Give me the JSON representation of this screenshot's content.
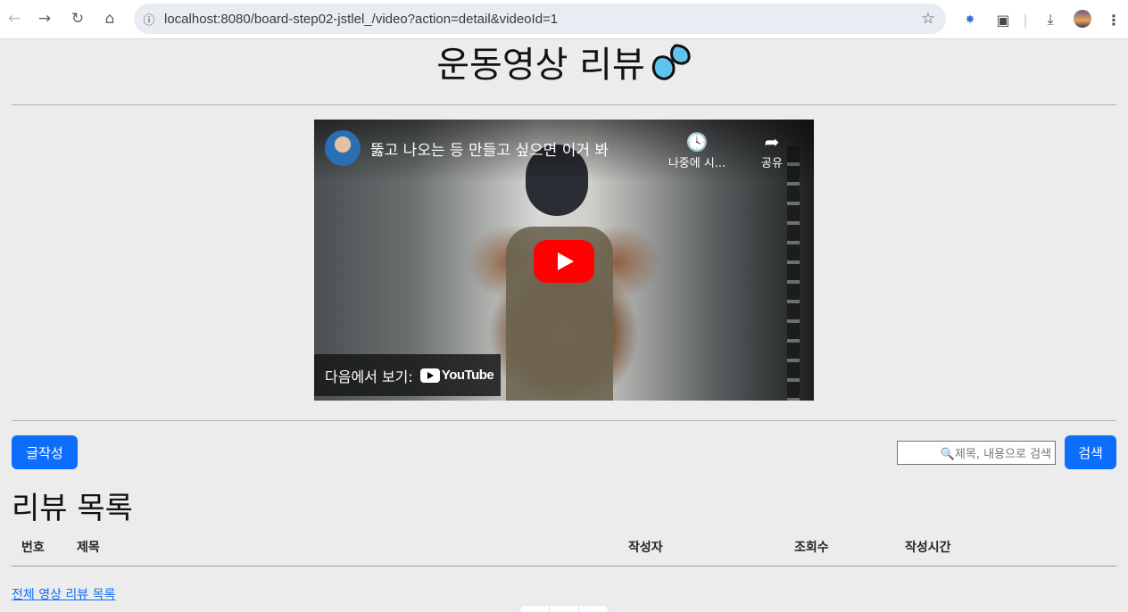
{
  "browser": {
    "url": "localhost:8080/board-step02-jstlel_/video?action=detail&videoId=1"
  },
  "page": {
    "title": "운동영상 리뷰",
    "title_emoji": "sweat-droplets-icon"
  },
  "video": {
    "title": "뚫고 나오는 등 만들고 싶으면 이거 봐",
    "watch_later_label": "나중에 시...",
    "share_label": "공유",
    "watch_on_label": "다음에서 보기:",
    "youtube_label": "YouTube"
  },
  "toolbar": {
    "write_label": "글작성",
    "search_placeholder": "🔍제목, 내용으로 검색",
    "search_label": "검색"
  },
  "review_list": {
    "title": "리뷰 목록",
    "columns": [
      "번호",
      "제목",
      "작성자",
      "조회수",
      "작성시간"
    ],
    "rows": [],
    "all_link": "전체 영상 리뷰 목록"
  },
  "colors": {
    "primary": "#0d6efd",
    "background": "#ececec",
    "youtube_red": "#ff0000"
  }
}
